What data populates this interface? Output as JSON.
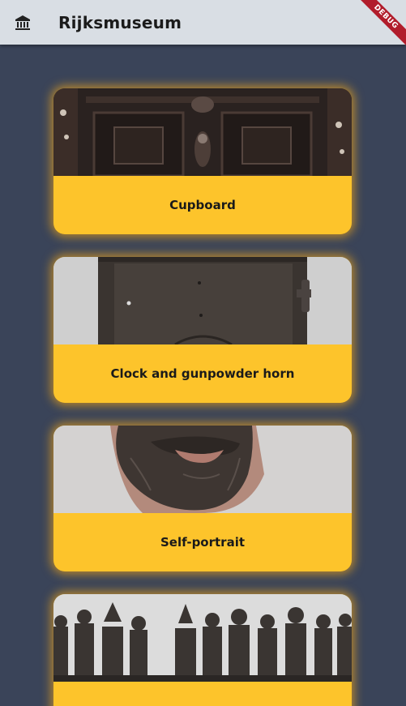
{
  "appbar": {
    "title": "Rijksmuseum",
    "menu_icon": "museum-icon",
    "background": "#d9dee4"
  },
  "debug_banner": {
    "label": "DEBUG",
    "color": "#b11c2b"
  },
  "theme": {
    "page_background": "#3a4459",
    "card_color": "#fdc42b"
  },
  "artworks": [
    {
      "title": "Cupboard",
      "image": "cupboard-photo"
    },
    {
      "title": "Clock and gunpowder horn",
      "image": "clock-photo"
    },
    {
      "title": "Self-portrait",
      "image": "beard-sculpture-photo"
    },
    {
      "title": "",
      "image": "statuettes-photo"
    }
  ]
}
